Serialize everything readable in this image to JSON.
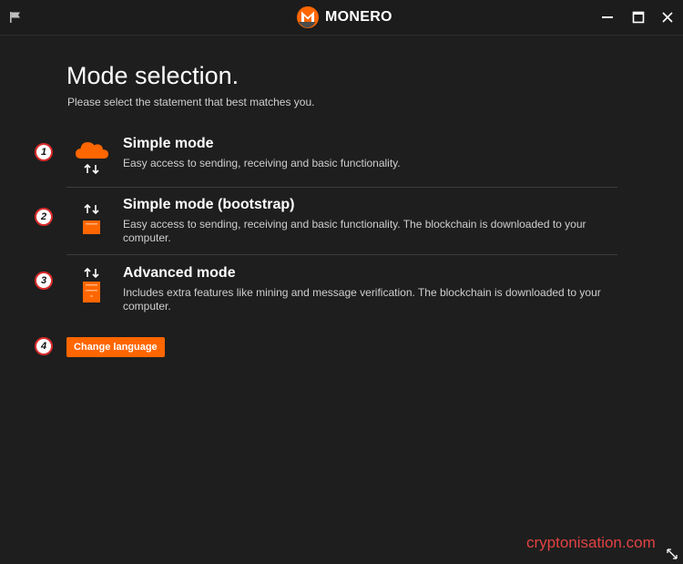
{
  "app": {
    "brand_name": "MONERO",
    "icons": [
      "flag-icon",
      "monero-logo-icon",
      "minimize-icon",
      "maximize-icon",
      "close-icon"
    ]
  },
  "page": {
    "title": "Mode selection.",
    "subtitle": "Please select the statement that best matches you."
  },
  "modes": [
    {
      "number": "1",
      "title": "Simple mode",
      "description": "Easy access to sending, receiving and basic functionality.",
      "icon": "cloud-sync-icon"
    },
    {
      "number": "2",
      "title": "Simple mode (bootstrap)",
      "description": "Easy access to sending, receiving and basic functionality. The blockchain is downloaded to your computer.",
      "icon": "bootstrap-node-icon"
    },
    {
      "number": "3",
      "title": "Advanced mode",
      "description": "Includes extra features like mining and message verification. The blockchain is downloaded to your computer.",
      "icon": "full-node-icon"
    }
  ],
  "change_language": {
    "number": "4",
    "label": "Change language"
  },
  "watermark": "cryptonisation.com",
  "colors": {
    "accent": "#ff6600",
    "background": "#1e1e1e",
    "annotation": "#d92b2b",
    "watermark": "#e34242"
  }
}
